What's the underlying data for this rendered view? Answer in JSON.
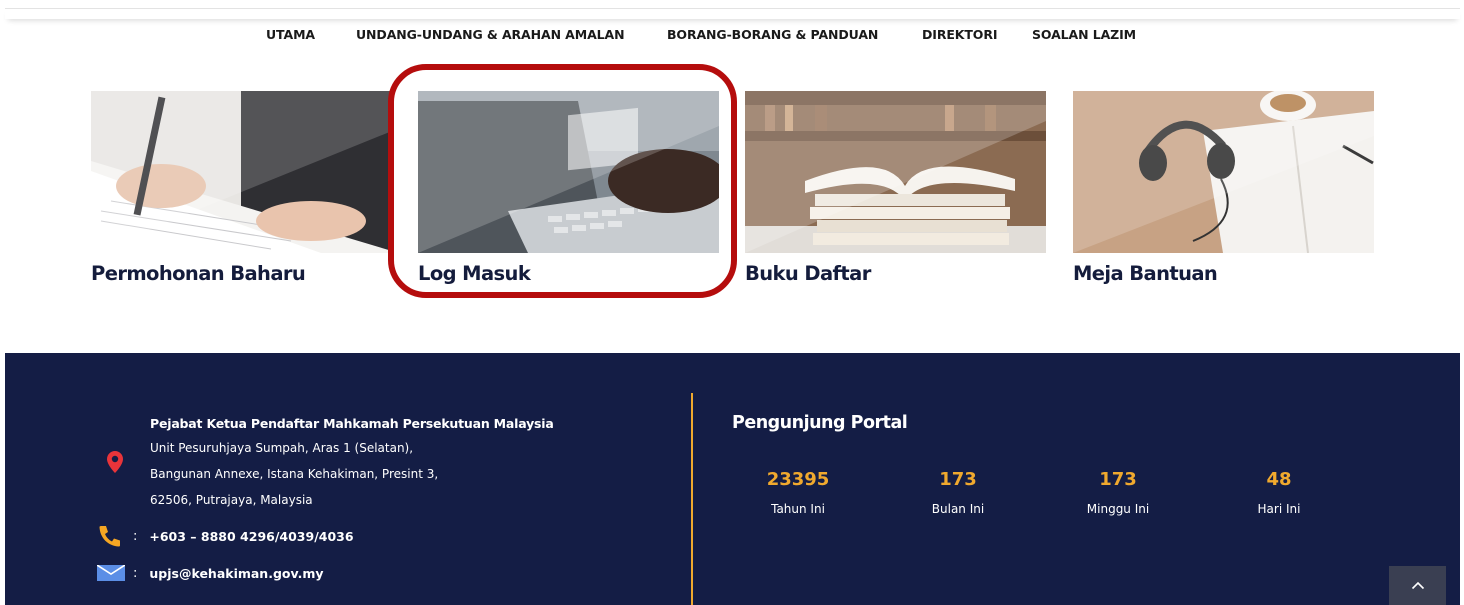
{
  "nav": {
    "items": [
      {
        "label": "UTAMA"
      },
      {
        "label": "UNDANG-UNDANG & ARAHAN AMALAN"
      },
      {
        "label": "BORANG-BORANG & PANDUAN"
      },
      {
        "label": "DIREKTORI"
      },
      {
        "label": "SOALAN LAZIM"
      }
    ]
  },
  "cards": [
    {
      "title": "Permohonan Baharu",
      "image": "writing-hand-image"
    },
    {
      "title": "Log Masuk",
      "image": "laptop-typing-image"
    },
    {
      "title": "Buku Daftar",
      "image": "books-stack-image"
    },
    {
      "title": "Meja Bantuan",
      "image": "headphones-desk-image"
    }
  ],
  "footer": {
    "office_name": "Pejabat Ketua Pendaftar Mahkamah Persekutuan Malaysia",
    "address_lines": [
      "Unit Pesuruhjaya Sumpah, Aras 1 (Selatan),",
      "Bangunan Annexe, Istana Kehakiman, Presint 3,",
      "62506, Putrajaya, Malaysia"
    ],
    "phone_separator": ":",
    "phone": "+603 – 8880 4296/4039/4036",
    "email_separator": ":",
    "email": "upjs@kehakiman.gov.my",
    "visitors_title": "Pengunjung Portal",
    "stats": [
      {
        "value": "23395",
        "label": "Tahun Ini"
      },
      {
        "value": "173",
        "label": "Bulan Ini"
      },
      {
        "value": "173",
        "label": "Minggu Ini"
      },
      {
        "value": "48",
        "label": "Hari Ini"
      }
    ]
  },
  "colors": {
    "footer_bg": "#141d45",
    "accent": "#f0a92e",
    "highlight": "#b50d0d",
    "pin": "#e8343a",
    "phone_icon": "#f5a623",
    "mail_icon": "#5b8ee6"
  },
  "icons": {
    "pin": "map-pin-icon",
    "phone": "phone-icon",
    "mail": "mail-icon",
    "scroll_top": "chevron-up-icon"
  }
}
